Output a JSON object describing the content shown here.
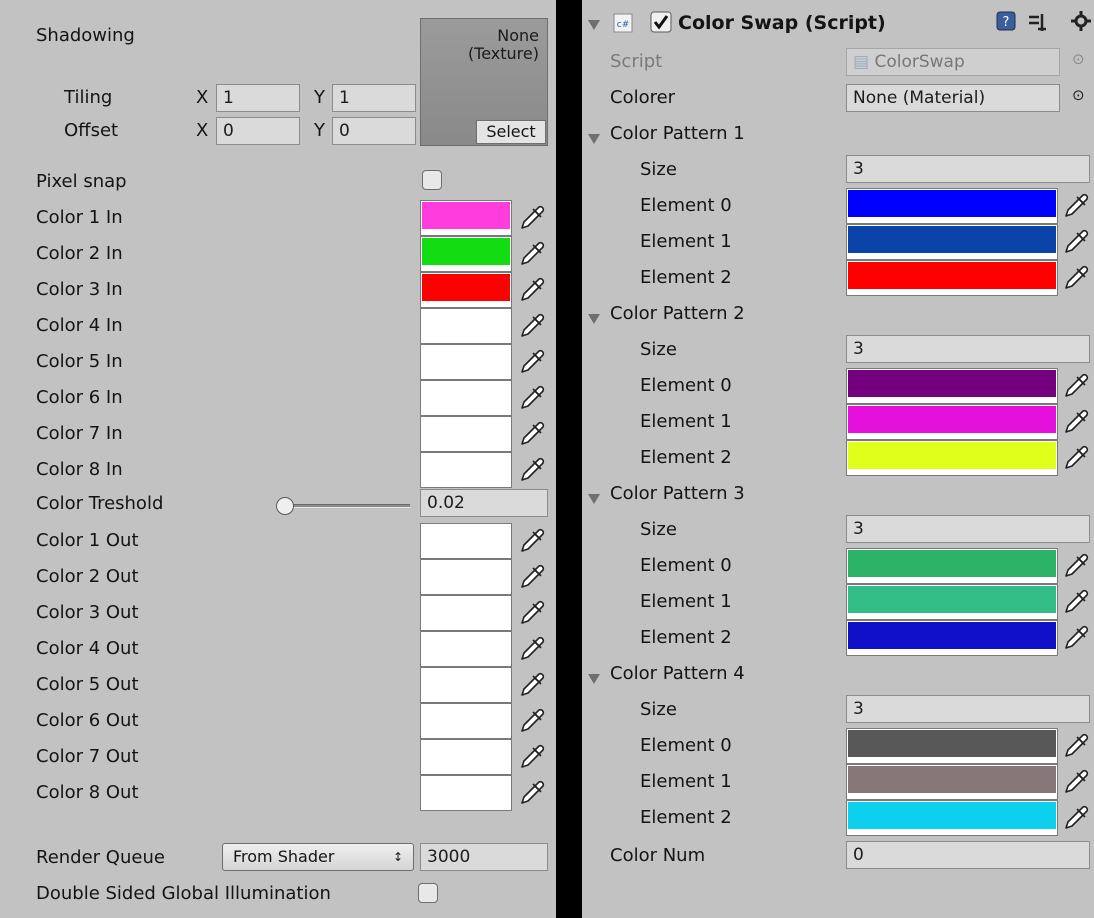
{
  "left": {
    "shadowing_label": "Shadowing",
    "texture": {
      "none_label": "None\n(Texture)",
      "line1": "None",
      "line2": "(Texture)",
      "select_label": "Select"
    },
    "tiling": {
      "label": "Tiling",
      "x_label": "X",
      "x_value": "1",
      "y_label": "Y",
      "y_value": "1"
    },
    "offset": {
      "label": "Offset",
      "x_label": "X",
      "x_value": "0",
      "y_label": "Y",
      "y_value": "0"
    },
    "pixel_snap_label": "Pixel snap",
    "colors_in": [
      {
        "label": "Color 1 In",
        "color": "#ff3cdc"
      },
      {
        "label": "Color 2 In",
        "color": "#13dc13"
      },
      {
        "label": "Color 3 In",
        "color": "#ff0000"
      },
      {
        "label": "Color 4 In",
        "color": "#ffffff"
      },
      {
        "label": "Color 5 In",
        "color": "#ffffff"
      },
      {
        "label": "Color 6 In",
        "color": "#ffffff"
      },
      {
        "label": "Color 7 In",
        "color": "#ffffff"
      },
      {
        "label": "Color 8 In",
        "color": "#ffffff"
      }
    ],
    "threshold": {
      "label": "Color Treshold",
      "value": "0.02",
      "fraction": 0.02
    },
    "colors_out": [
      {
        "label": "Color 1 Out",
        "color": "#ffffff"
      },
      {
        "label": "Color 2 Out",
        "color": "#ffffff"
      },
      {
        "label": "Color 3 Out",
        "color": "#ffffff"
      },
      {
        "label": "Color 4 Out",
        "color": "#ffffff"
      },
      {
        "label": "Color 5 Out",
        "color": "#ffffff"
      },
      {
        "label": "Color 6 Out",
        "color": "#ffffff"
      },
      {
        "label": "Color 7 Out",
        "color": "#ffffff"
      },
      {
        "label": "Color 8 Out",
        "color": "#ffffff"
      }
    ],
    "render_queue": {
      "label": "Render Queue",
      "dropdown": "From Shader",
      "value": "3000"
    },
    "double_sided_label": "Double Sided Global Illumination"
  },
  "right": {
    "component": {
      "title": "Color Swap (Script)",
      "enabled": true,
      "script_icon": "script-icon"
    },
    "script": {
      "label": "Script",
      "value": "ColorSwap"
    },
    "colorer": {
      "label": "Colorer",
      "value": "None (Material)"
    },
    "patterns": [
      {
        "title": "Color Pattern 1",
        "size_label": "Size",
        "size": "3",
        "elements": [
          {
            "label": "Element 0",
            "color": "#0000ff"
          },
          {
            "label": "Element 1",
            "color": "#0a44a8"
          },
          {
            "label": "Element 2",
            "color": "#ff0000"
          }
        ]
      },
      {
        "title": "Color Pattern 2",
        "size_label": "Size",
        "size": "3",
        "elements": [
          {
            "label": "Element 0",
            "color": "#74007e"
          },
          {
            "label": "Element 1",
            "color": "#e410dc"
          },
          {
            "label": "Element 2",
            "color": "#e0ff1a"
          }
        ]
      },
      {
        "title": "Color Pattern 3",
        "size_label": "Size",
        "size": "3",
        "elements": [
          {
            "label": "Element 0",
            "color": "#2db368"
          },
          {
            "label": "Element 1",
            "color": "#33bd86"
          },
          {
            "label": "Element 2",
            "color": "#1010c8"
          }
        ]
      },
      {
        "title": "Color Pattern 4",
        "size_label": "Size",
        "size": "3",
        "elements": [
          {
            "label": "Element 0",
            "color": "#585858"
          },
          {
            "label": "Element 1",
            "color": "#857777"
          },
          {
            "label": "Element 2",
            "color": "#0cd0ee"
          }
        ]
      }
    ],
    "color_num": {
      "label": "Color Num",
      "value": "0"
    }
  }
}
